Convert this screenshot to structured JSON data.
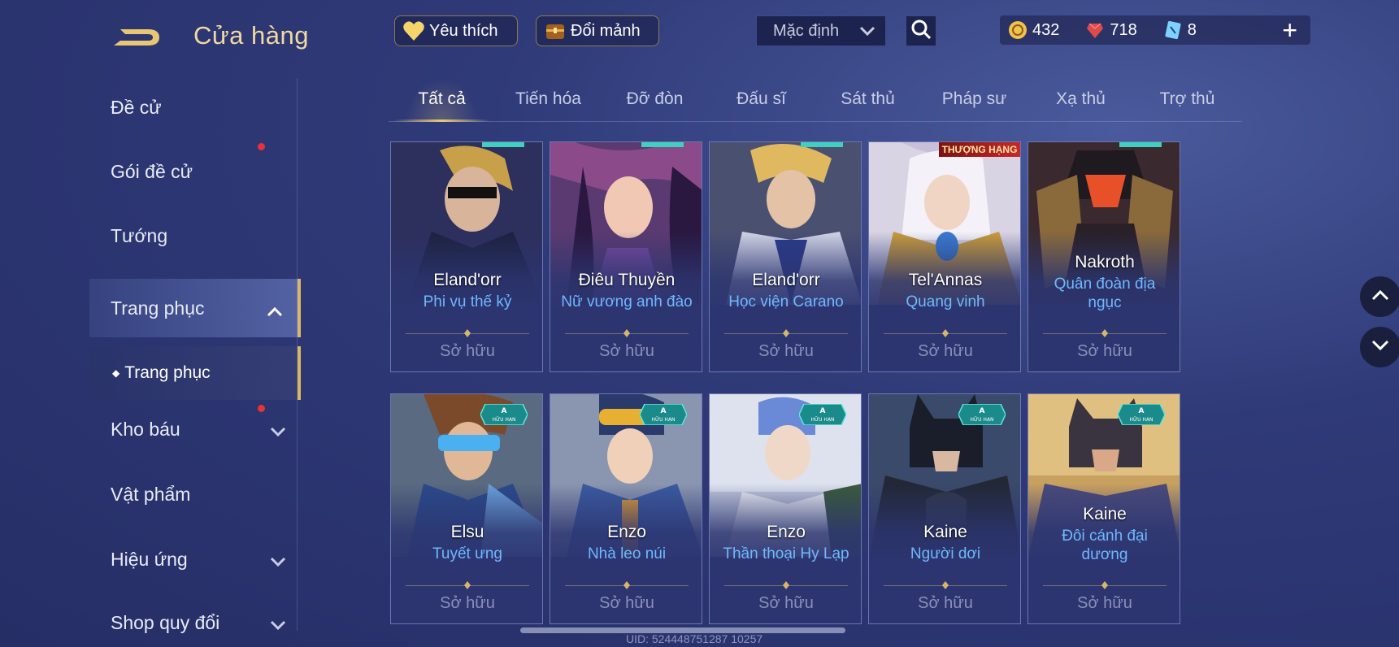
{
  "header": {
    "title": "Cửa hàng",
    "favorites_label": "Yêu thích",
    "exchange_label": "Đổi mảnh",
    "sort_value": "Mặc định",
    "currencies": [
      {
        "icon": "gold-coin-icon",
        "value": "432"
      },
      {
        "icon": "red-gem-icon",
        "value": "718"
      },
      {
        "icon": "voucher-icon",
        "value": "8"
      }
    ]
  },
  "sidebar": {
    "items": [
      {
        "label": "Đề cử"
      },
      {
        "label": "Gói đề cử"
      },
      {
        "label": "Tướng"
      },
      {
        "label": "Trang phục"
      },
      {
        "label": "Kho báu"
      },
      {
        "label": "Vật phẩm"
      },
      {
        "label": "Hiệu ứng"
      },
      {
        "label": "Shop quy đổi"
      }
    ],
    "sub_item": "Trang phục"
  },
  "tabs": [
    "Tất cả",
    "Tiến hóa",
    "Đỡ đòn",
    "Đấu sĩ",
    "Sát thủ",
    "Pháp sư",
    "Xạ thủ",
    "Trợ thủ"
  ],
  "cards": [
    {
      "hero": "Eland'orr",
      "skin": "Phi vụ thế kỷ",
      "status": "Sở hữu"
    },
    {
      "hero": "Điêu Thuyền",
      "skin": "Nữ vương anh đào",
      "status": "Sở hữu"
    },
    {
      "hero": "Eland'orr",
      "skin": "Học viện Carano",
      "status": "Sở hữu"
    },
    {
      "hero": "Tel'Annas",
      "skin": "Quang vinh",
      "status": "Sở hữu",
      "badge": "THƯỢNG HẠNG"
    },
    {
      "hero": "Nakroth",
      "skin_line1": "Quân đoàn địa",
      "skin_line2": "ngục",
      "status": "Sở hữu"
    },
    {
      "hero": "Elsu",
      "skin": "Tuyết ưng",
      "status": "Sở hữu",
      "tag": "A",
      "tag_sub": "HỮU HẠN"
    },
    {
      "hero": "Enzo",
      "skin": "Nhà leo núi",
      "status": "Sở hữu",
      "tag": "A",
      "tag_sub": "HỮU HẠN"
    },
    {
      "hero": "Enzo",
      "skin": "Thần thoại Hy Lạp",
      "status": "Sở hữu",
      "tag": "A",
      "tag_sub": "HỮU HẠN"
    },
    {
      "hero": "Kaine",
      "skin": "Người dơi",
      "status": "Sở hữu",
      "tag": "A",
      "tag_sub": "HỮU HẠN"
    },
    {
      "hero": "Kaine",
      "skin_line1": "Đôi cánh đại",
      "skin_line2": "dương",
      "status": "Sở hữu",
      "tag": "A",
      "tag_sub": "HỮU HẠN"
    }
  ],
  "uid": "UID: 524448751287 10257",
  "colors": {
    "accent_gold": "#e7c878",
    "skin_blue": "#6fb8ff",
    "bg": "#2f3a78"
  }
}
